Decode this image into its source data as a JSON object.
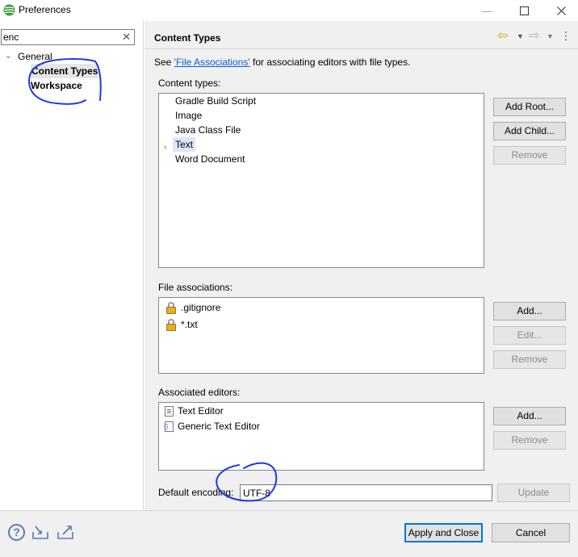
{
  "window": {
    "title": "Preferences"
  },
  "filter": {
    "value": "enc"
  },
  "tree": {
    "root": "General",
    "children": [
      "Content Types",
      "Workspace"
    ]
  },
  "page": {
    "title": "Content Types",
    "see_prefix": "See ",
    "see_link": "'File Associations'",
    "see_suffix": " for associating editors with file types."
  },
  "content_types": {
    "label": "Content types:",
    "items": [
      "Gradle Build Script",
      "Image",
      "Java Class File",
      "Text",
      "Word Document"
    ],
    "selected": "Text",
    "buttons": {
      "add_root": "Add Root...",
      "add_child": "Add Child...",
      "remove": "Remove"
    }
  },
  "file_associations": {
    "label": "File associations:",
    "items": [
      ".gitignore",
      "*.txt"
    ],
    "buttons": {
      "add": "Add...",
      "edit": "Edit...",
      "remove": "Remove"
    }
  },
  "associated_editors": {
    "label": "Associated editors:",
    "items": [
      "Text Editor",
      "Generic Text Editor"
    ],
    "buttons": {
      "add": "Add...",
      "remove": "Remove"
    }
  },
  "encoding": {
    "label": "Default encoding:",
    "value": "UTF-8",
    "update": "Update"
  },
  "footer": {
    "apply_close": "Apply and Close",
    "cancel": "Cancel"
  },
  "colors": {
    "link": "#0b5fd0",
    "selection": "#dbe8f7",
    "annotation": "#1a3be0",
    "default_button_border": "#0078d7"
  }
}
